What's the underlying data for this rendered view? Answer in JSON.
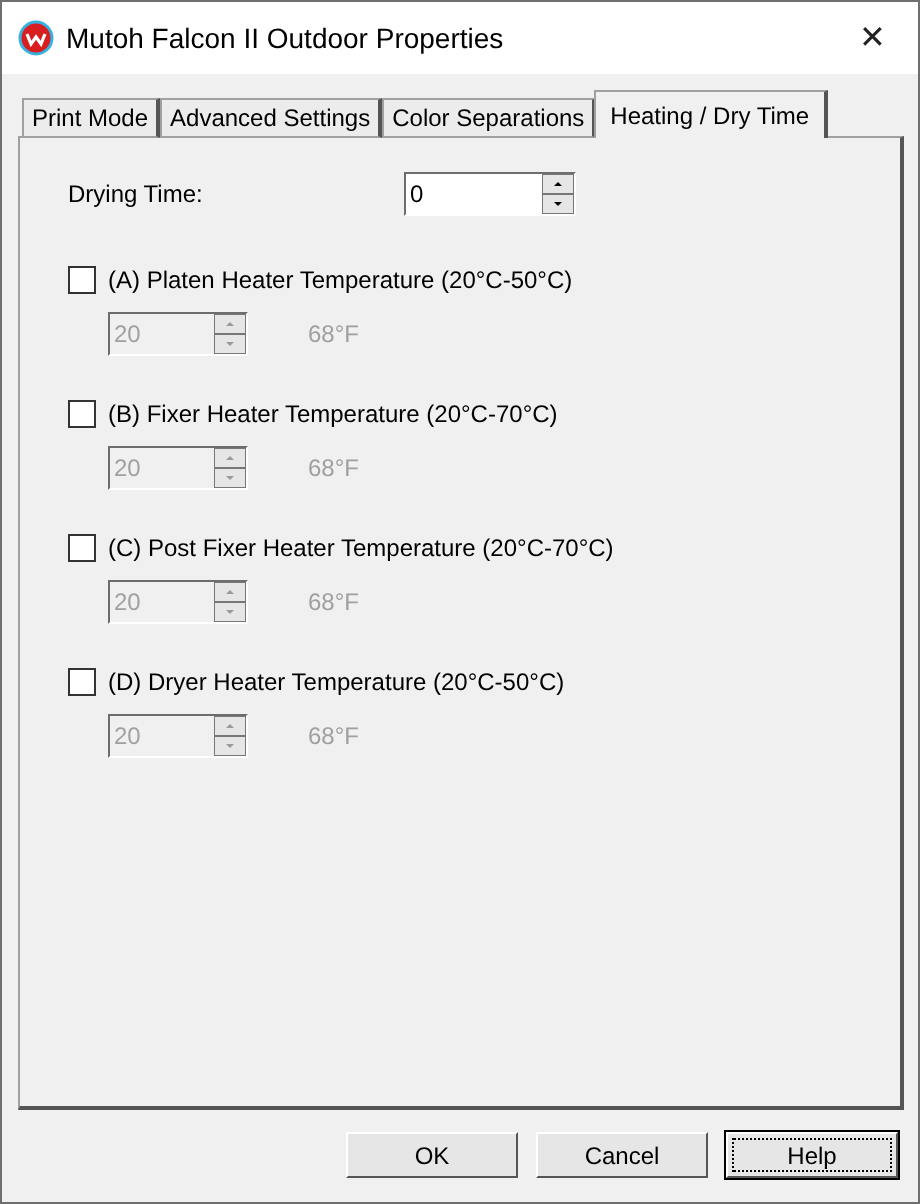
{
  "window": {
    "title": "Mutoh Falcon II Outdoor Properties",
    "close": "✕"
  },
  "tabs": [
    {
      "label": "Print Mode",
      "selected": false
    },
    {
      "label": "Advanced Settings",
      "selected": false
    },
    {
      "label": "Color Separations",
      "selected": false
    },
    {
      "label": "Heating / Dry Time",
      "selected": true
    }
  ],
  "drying_time": {
    "label": "Drying Time:",
    "value": "0"
  },
  "heaters": [
    {
      "label": "(A) Platen Heater Temperature (20°C-50°C)",
      "checked": false,
      "value": "20",
      "fahrenheit": "68°F"
    },
    {
      "label": "(B) Fixer Heater Temperature (20°C-70°C)",
      "checked": false,
      "value": "20",
      "fahrenheit": "68°F"
    },
    {
      "label": "(C) Post Fixer Heater Temperature (20°C-70°C)",
      "checked": false,
      "value": "20",
      "fahrenheit": "68°F"
    },
    {
      "label": "(D) Dryer Heater Temperature (20°C-50°C)",
      "checked": false,
      "value": "20",
      "fahrenheit": "68°F"
    }
  ],
  "buttons": [
    {
      "label": "OK",
      "focused": false
    },
    {
      "label": "Cancel",
      "focused": false
    },
    {
      "label": "Help",
      "focused": true
    }
  ]
}
